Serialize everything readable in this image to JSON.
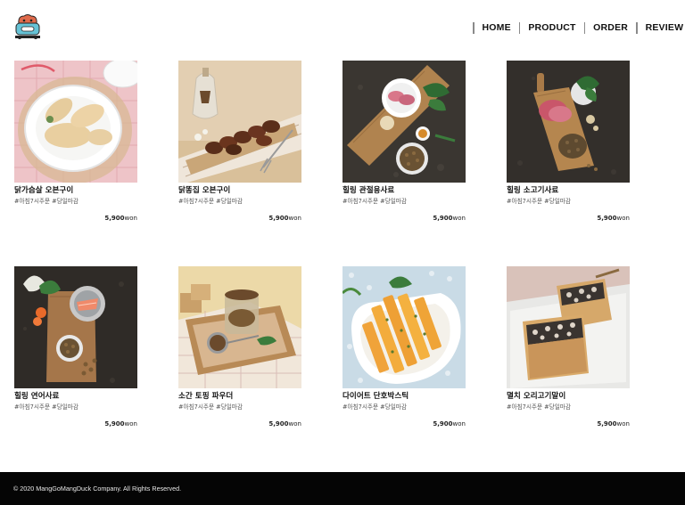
{
  "header": {
    "logo_icon": "dog-bone-logo-icon",
    "nav": [
      {
        "label": "HOME"
      },
      {
        "label": "PRODUCT"
      },
      {
        "label": "ORDER"
      },
      {
        "label": "REVIEW"
      }
    ]
  },
  "products": [
    {
      "name": "닭가슴살 오븐구이",
      "tags": "#아침7시주문 #당일마감",
      "price": "5,900",
      "currency": "won",
      "image": "chicken-breast-plate"
    },
    {
      "name": "닭똥집 오븐구이",
      "tags": "#아침7시주문 #당일마감",
      "price": "5,900",
      "currency": "won",
      "image": "gizzard-board"
    },
    {
      "name": "힐링 관절용사료",
      "tags": "#아침7시주문 #당일마감",
      "price": "5,900",
      "currency": "won",
      "image": "joint-food-board"
    },
    {
      "name": "힐링 소고기사료",
      "tags": "#아침7시주문 #당일마감",
      "price": "5,900",
      "currency": "won",
      "image": "beef-food-board"
    },
    {
      "name": "힐링 연어사료",
      "tags": "#아침7시주문 #당일마감",
      "price": "5,900",
      "currency": "won",
      "image": "salmon-food-board"
    },
    {
      "name": "소간 토핑 파우더",
      "tags": "#아침7시주문 #당일마감",
      "price": "5,900",
      "currency": "won",
      "image": "liver-powder-tray"
    },
    {
      "name": "다이어트 단호박스틱",
      "tags": "#아침7시주문 #당일마감",
      "price": "5,900",
      "currency": "won",
      "image": "pumpkin-sticks"
    },
    {
      "name": "멸치 오리고기말이",
      "tags": "#아침7시주문 #당일마감",
      "price": "5,900",
      "currency": "won",
      "image": "anchovy-duck-boxes"
    }
  ],
  "footer": {
    "copyright": "© 2020 MangGoMangDuck Company. All Rights Reserved."
  },
  "colors": {
    "footer_bg": "#050505",
    "nav_divider": "#8a8a8a",
    "text": "#111111"
  }
}
